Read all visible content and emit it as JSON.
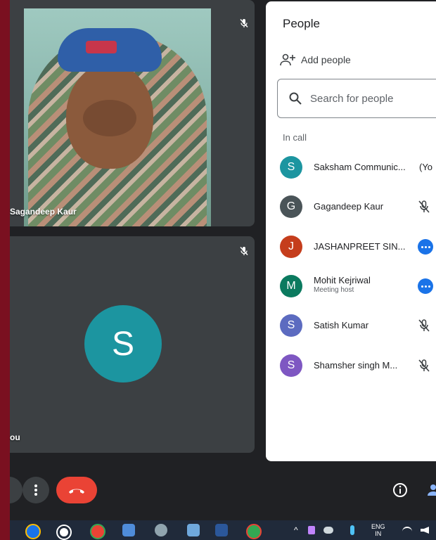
{
  "tiles": {
    "top": {
      "name": "Gagandeep Kaur",
      "display_name": "Sagandeep Kaur"
    },
    "bottom": {
      "name": "You",
      "display_name": "ou",
      "avatar_letter": "S",
      "avatar_color": "#1c95a0"
    }
  },
  "panel": {
    "title": "People",
    "add_people_label": "Add people",
    "search_placeholder": "Search for people",
    "section_label": "In call",
    "participants": [
      {
        "letter": "S",
        "name": "Saksham Communic...",
        "suffix": "(Yo",
        "color": "#1c95a0",
        "status": "you"
      },
      {
        "letter": "G",
        "name": "Gagandeep Kaur",
        "color": "#4a5458",
        "status": "muted"
      },
      {
        "letter": "J",
        "name": "JASHANPREET SIN...",
        "color": "#c53d1c",
        "status": "more"
      },
      {
        "letter": "M",
        "name": "Mohit Kejriwal",
        "subtitle": "Meeting host",
        "color": "#0b7a5f",
        "status": "more"
      },
      {
        "letter": "S",
        "name": "Satish Kumar",
        "color": "#5c6bc0",
        "status": "muted"
      },
      {
        "letter": "S",
        "name": "Shamsher singh M...",
        "color": "#7e57c2",
        "status": "muted"
      }
    ]
  },
  "controls": {
    "more_icon": "more-vert-icon",
    "end_call_icon": "call-end-icon",
    "info_icon": "info-icon",
    "people_icon": "people-icon",
    "end_call_color": "#ea4335"
  },
  "taskbar": {
    "language": "ENG",
    "region": "IN"
  }
}
